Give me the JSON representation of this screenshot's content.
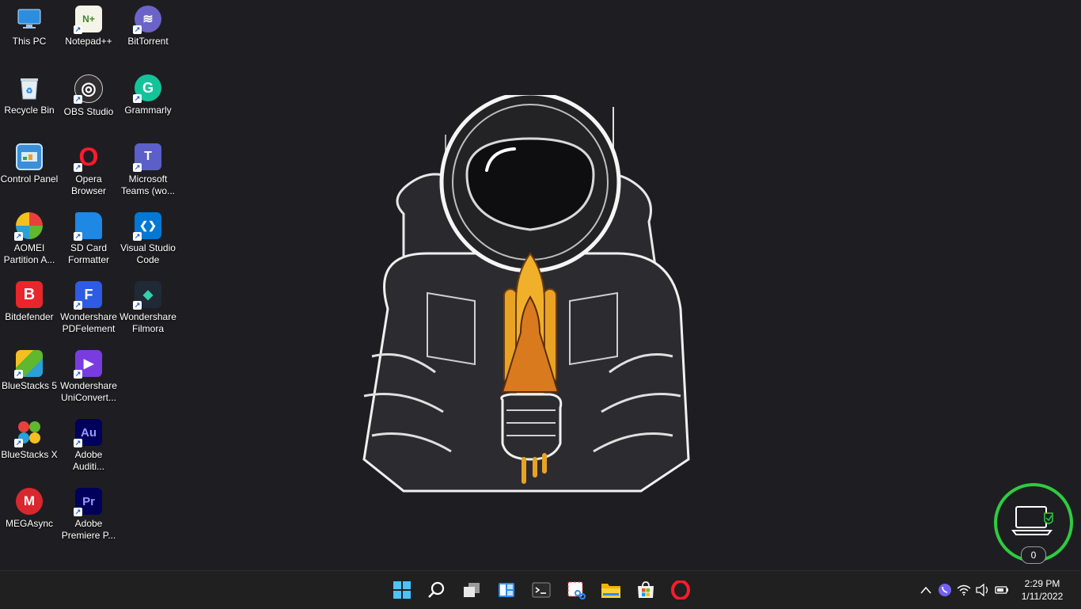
{
  "desktop_icons": [
    {
      "label": "This PC",
      "icon": "this-pc-icon",
      "color": "#2b8ee0"
    },
    {
      "label": "Notepad++",
      "icon": "notepad-plus-plus-icon",
      "color": "#7fbf3f"
    },
    {
      "label": "BitTorrent",
      "icon": "bittorrent-icon",
      "color": "#6c63c8"
    },
    {
      "label": "Recycle Bin",
      "icon": "recycle-bin-icon",
      "color": "#cfd8e0"
    },
    {
      "label": "OBS Studio",
      "icon": "obs-studio-icon",
      "color": "#302e31"
    },
    {
      "label": "Grammarly",
      "icon": "grammarly-icon",
      "color": "#15c39a"
    },
    {
      "label": "Control Panel",
      "icon": "control-panel-icon",
      "color": "#3a8fd8"
    },
    {
      "label": "Opera Browser",
      "icon": "opera-icon",
      "color": "#ff1b2d"
    },
    {
      "label": "Microsoft Teams (wo...",
      "icon": "microsoft-teams-icon",
      "color": "#5b5fc7"
    },
    {
      "label": "AOMEI Partition A...",
      "icon": "aomei-partition-icon",
      "color": "#2a9fd8"
    },
    {
      "label": "SD Card Formatter",
      "icon": "sd-card-formatter-icon",
      "color": "#1e88e5"
    },
    {
      "label": "Visual Studio Code",
      "icon": "vscode-icon",
      "color": "#0078d4"
    },
    {
      "label": "Bitdefender",
      "icon": "bitdefender-icon",
      "color": "#e8262b"
    },
    {
      "label": "Wondershare PDFelement",
      "icon": "pdfelement-icon",
      "color": "#2d5be3"
    },
    {
      "label": "Wondershare Filmora",
      "icon": "filmora-icon",
      "color": "#1f2a36"
    },
    {
      "label": "BlueStacks 5",
      "icon": "bluestacks-5-icon",
      "color": "#5fb82e"
    },
    {
      "label": "Wondershare UniConvert...",
      "icon": "uniconverter-icon",
      "color": "#7a3ce0"
    },
    {
      "label": "BlueStacks X",
      "icon": "bluestacks-x-icon",
      "color": "#e8403a"
    },
    {
      "label": "Adobe Auditi...",
      "icon": "adobe-audition-icon",
      "color": "#00005b"
    },
    {
      "label": "MEGAsync",
      "icon": "megasync-icon",
      "color": "#d9272e"
    },
    {
      "label": "Adobe Premiere P...",
      "icon": "adobe-premiere-icon",
      "color": "#00005b"
    }
  ],
  "icon_glyphs": {
    "obs": "◎",
    "grammarly": "G",
    "opera": "O",
    "teams": "T",
    "vscode": "❮❯",
    "bitdefender": "B",
    "pdfelement": "F",
    "filmora": "◆",
    "uniconverter": "▶",
    "audition": "Au",
    "mega": "M",
    "premiere": "Pr",
    "bittorrent": "≋",
    "notepad": "N+"
  },
  "taskbar": {
    "apps": [
      {
        "name": "start-button",
        "tooltip": "Start"
      },
      {
        "name": "search-button",
        "tooltip": "Search"
      },
      {
        "name": "task-view-button",
        "tooltip": "Task View"
      },
      {
        "name": "widgets-button",
        "tooltip": "Widgets"
      },
      {
        "name": "terminal-button",
        "tooltip": "Terminal"
      },
      {
        "name": "snipping-tool-button",
        "tooltip": "Snipping Tool"
      },
      {
        "name": "file-explorer-button",
        "tooltip": "File Explorer"
      },
      {
        "name": "microsoft-store-button",
        "tooltip": "Microsoft Store"
      },
      {
        "name": "opera-taskbar-button",
        "tooltip": "Opera"
      }
    ],
    "tray": {
      "chevron": "^",
      "clock_time": "2:29 PM",
      "clock_date": "1/11/2022"
    }
  },
  "vpn_widget": {
    "count": "0",
    "ring_color": "#2ecc40"
  }
}
